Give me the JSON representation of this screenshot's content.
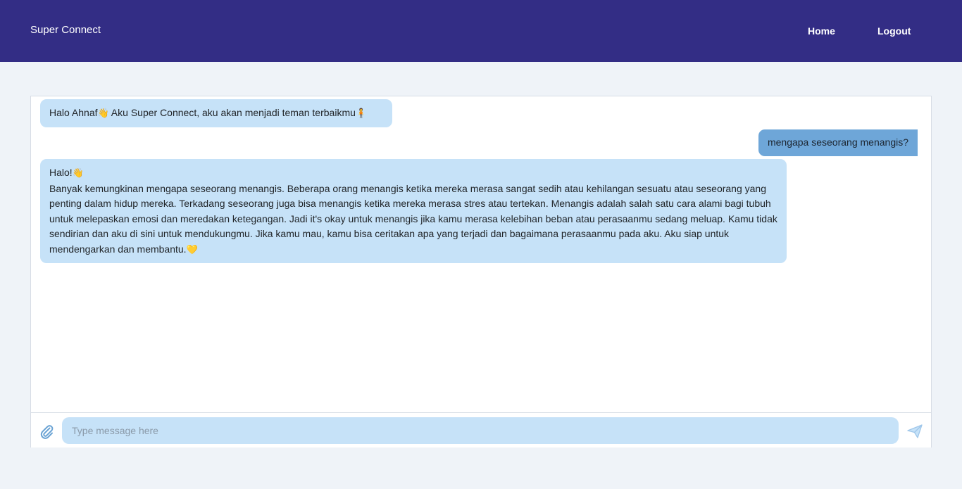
{
  "nav": {
    "brand": "Super Connect",
    "home_label": "Home",
    "logout_label": "Logout"
  },
  "chat": {
    "messages": [
      {
        "sender": "bot",
        "text": "Halo Ahnaf",
        "emoji_1": "👋",
        "text_2": " Aku Super Connect, aku akan menjadi teman terbaikmu",
        "emoji_2": "🧍"
      },
      {
        "sender": "user",
        "text": "mengapa seseorang menangis?"
      },
      {
        "sender": "bot",
        "greeting": "Halo!",
        "greeting_emoji": "👋",
        "body": "Banyak kemungkinan mengapa seseorang menangis. Beberapa orang menangis ketika mereka merasa sangat sedih atau kehilangan sesuatu atau seseorang yang penting dalam hidup mereka. Terkadang seseorang juga bisa menangis ketika mereka merasa stres atau tertekan. Menangis adalah salah satu cara alami bagi tubuh untuk melepaskan emosi dan meredakan ketegangan. Jadi it's okay untuk menangis jika kamu merasa kelebihan beban atau perasaanmu sedang meluap. Kamu tidak sendirian dan aku di sini untuk mendukungmu. Jika kamu mau, kamu bisa ceritakan apa yang terjadi dan bagaimana perasaanmu pada aku. Aku siap untuk mendengarkan dan membantu.",
        "closing_emoji": "💛"
      }
    ]
  },
  "composer": {
    "placeholder": "Type message here",
    "attach_icon": "paperclip-icon",
    "send_icon": "paper-plane-icon"
  },
  "colors": {
    "navbar": "#332d85",
    "page_bg": "#eff3f8",
    "bot_bubble": "#c6e2f8",
    "user_bubble": "#6ea6d8",
    "icon": "#6aa3d4"
  }
}
